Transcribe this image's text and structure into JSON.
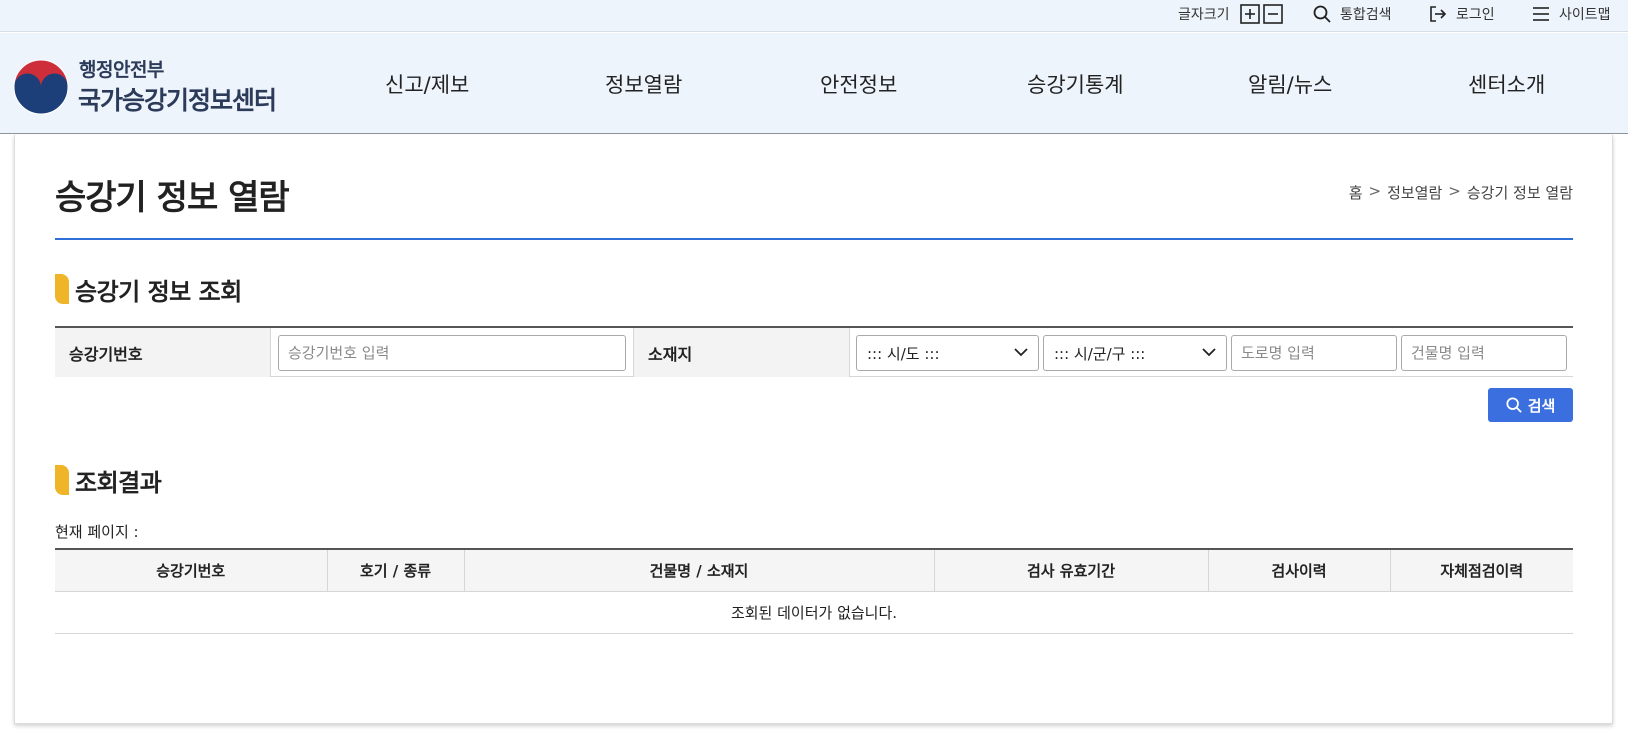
{
  "util": {
    "font_size_label": "글자크기",
    "search_label": "통합검색",
    "login_label": "로그인",
    "sitemap_label": "사이트맵"
  },
  "logo": {
    "sub": "행정안전부",
    "main": "국가승강기정보센터"
  },
  "gnb": {
    "items": [
      {
        "label": "신고/제보"
      },
      {
        "label": "정보열람"
      },
      {
        "label": "안전정보"
      },
      {
        "label": "승강기통계"
      },
      {
        "label": "알림/뉴스"
      },
      {
        "label": "센터소개"
      }
    ]
  },
  "page": {
    "title": "승강기 정보 열람",
    "breadcrumb": [
      "홈",
      ">",
      "정보열람",
      ">",
      "승강기 정보 열람"
    ]
  },
  "search": {
    "section_title": "승강기 정보 조회",
    "elevator_no_label": "승강기번호",
    "elevator_no_placeholder": "승강기번호 입력",
    "location_label": "소재지",
    "sido_selected": "::: 시/도 :::",
    "sigungu_selected": "::: 시/군/구 :::",
    "road_placeholder": "도로명 입력",
    "building_placeholder": "건물명 입력",
    "button_label": "검색"
  },
  "result": {
    "section_title": "조회결과",
    "current_page_label": "현재 페이지 :",
    "columns": [
      "승강기번호",
      "호기 / 종류",
      "건물명 / 소재지",
      "검사 유효기간",
      "검사이력",
      "자체점검이력"
    ],
    "empty_message": "조회된 데이터가 없습니다."
  },
  "colors": {
    "accent": "#3b6fe0",
    "header_bg": "#eef4fc",
    "section_marker": "#f0b428",
    "title_line": "#2f6fd6"
  }
}
